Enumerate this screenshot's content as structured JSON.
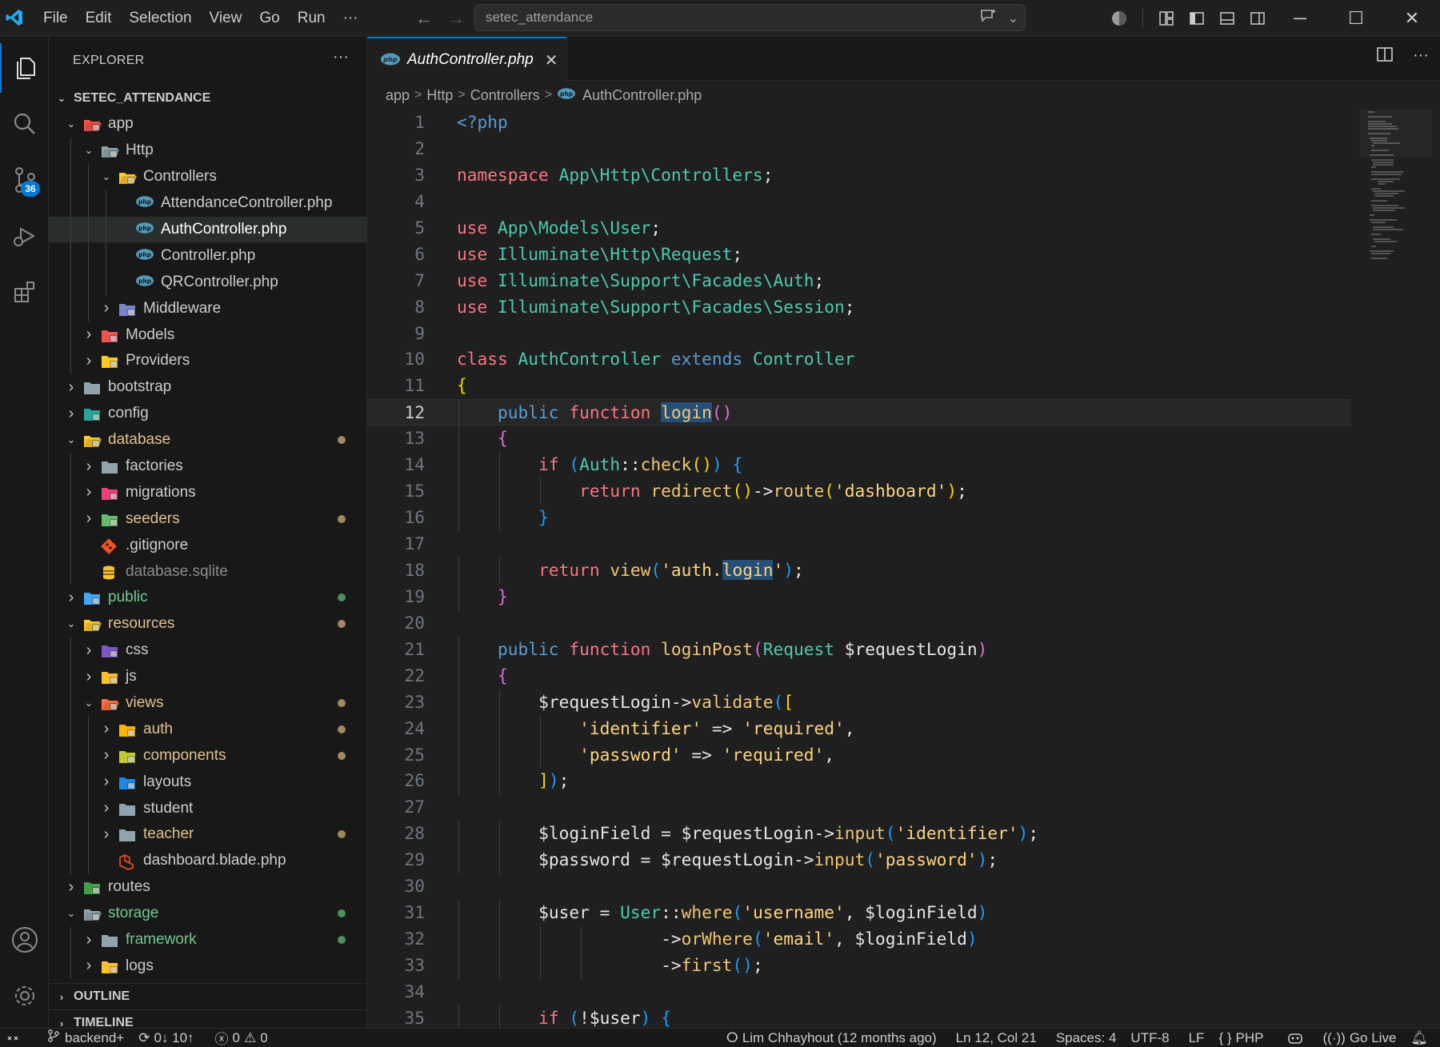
{
  "titlebar": {
    "menu": [
      "File",
      "Edit",
      "Selection",
      "View",
      "Go",
      "Run",
      "···"
    ],
    "search_text": "setec_attendance"
  },
  "activity": {
    "scm_badge": "36"
  },
  "sidebar": {
    "explorer_title": "EXPLORER",
    "project_name": "SETEC_ATTENDANCE",
    "tree": [
      {
        "label": "app",
        "depth": 0,
        "twisty": "open",
        "icon": "folder-app-icon",
        "color": "#f85149",
        "labelColor": "#cccccc"
      },
      {
        "label": "Http",
        "depth": 1,
        "twisty": "open",
        "icon": "folder-http-icon",
        "color": "#90a4ae",
        "labelColor": "#cccccc"
      },
      {
        "label": "Controllers",
        "depth": 2,
        "twisty": "open",
        "icon": "folder-controllers-icon",
        "color": "#ffca28",
        "labelColor": "#cccccc"
      },
      {
        "label": "AttendanceController.php",
        "depth": 3,
        "twisty": "none",
        "icon": "php-file-icon",
        "color": "#519aba",
        "labelColor": "#cccccc"
      },
      {
        "label": "AuthController.php",
        "depth": 3,
        "twisty": "none",
        "icon": "php-file-icon",
        "color": "#519aba",
        "labelColor": "#ffffff",
        "selected": true
      },
      {
        "label": "Controller.php",
        "depth": 3,
        "twisty": "none",
        "icon": "php-file-icon",
        "color": "#519aba",
        "labelColor": "#cccccc"
      },
      {
        "label": "QRController.php",
        "depth": 3,
        "twisty": "none",
        "icon": "php-file-icon",
        "color": "#519aba",
        "labelColor": "#cccccc"
      },
      {
        "label": "Middleware",
        "depth": 2,
        "twisty": "closed",
        "icon": "folder-middleware-icon",
        "color": "#7986cb",
        "labelColor": "#cccccc"
      },
      {
        "label": "Models",
        "depth": 1,
        "twisty": "closed",
        "icon": "folder-models-icon",
        "color": "#ef5350",
        "labelColor": "#cccccc"
      },
      {
        "label": "Providers",
        "depth": 1,
        "twisty": "closed",
        "icon": "folder-providers-icon",
        "color": "#ffca28",
        "labelColor": "#cccccc"
      },
      {
        "label": "bootstrap",
        "depth": 0,
        "twisty": "closed",
        "icon": "folder-icon",
        "color": "#90a4ae",
        "labelColor": "#cccccc"
      },
      {
        "label": "config",
        "depth": 0,
        "twisty": "closed",
        "icon": "folder-config-icon",
        "color": "#26a69a",
        "labelColor": "#cccccc"
      },
      {
        "label": "database",
        "depth": 0,
        "twisty": "open",
        "icon": "folder-database-icon",
        "color": "#ffca28",
        "labelColor": "#e2c08d",
        "dot": "#a08860"
      },
      {
        "label": "factories",
        "depth": 1,
        "twisty": "closed",
        "icon": "folder-icon",
        "color": "#90a4ae",
        "labelColor": "#cccccc"
      },
      {
        "label": "migrations",
        "depth": 1,
        "twisty": "closed",
        "icon": "folder-migrations-icon",
        "color": "#ec407a",
        "labelColor": "#cccccc"
      },
      {
        "label": "seeders",
        "depth": 1,
        "twisty": "closed",
        "icon": "folder-seeders-icon",
        "color": "#66bb6a",
        "labelColor": "#e2c08d",
        "dot": "#a08860"
      },
      {
        "label": ".gitignore",
        "depth": 1,
        "twisty": "none",
        "icon": "git-icon",
        "color": "#f4511e",
        "labelColor": "#cccccc"
      },
      {
        "label": "database.sqlite",
        "depth": 1,
        "twisty": "none",
        "icon": "database-icon",
        "color": "#fbc02d",
        "labelColor": "#8c8c8c"
      },
      {
        "label": "public",
        "depth": 0,
        "twisty": "closed",
        "icon": "folder-public-icon",
        "color": "#42a5f5",
        "labelColor": "#73c991",
        "dot": "#4e8f5e"
      },
      {
        "label": "resources",
        "depth": 0,
        "twisty": "open",
        "icon": "folder-resources-icon",
        "color": "#ffca28",
        "labelColor": "#e2c08d",
        "dot": "#a08860"
      },
      {
        "label": "css",
        "depth": 1,
        "twisty": "closed",
        "icon": "folder-css-icon",
        "color": "#7e57c2",
        "labelColor": "#cccccc"
      },
      {
        "label": "js",
        "depth": 1,
        "twisty": "closed",
        "icon": "folder-js-icon",
        "color": "#fbc02d",
        "labelColor": "#cccccc"
      },
      {
        "label": "views",
        "depth": 1,
        "twisty": "open",
        "icon": "folder-views-icon",
        "color": "#ff7043",
        "labelColor": "#e2c08d",
        "dot": "#a08860"
      },
      {
        "label": "auth",
        "depth": 2,
        "twisty": "closed",
        "icon": "folder-auth-icon",
        "color": "#ffb300",
        "labelColor": "#e2c08d",
        "dot": "#a08860"
      },
      {
        "label": "components",
        "depth": 2,
        "twisty": "closed",
        "icon": "folder-components-icon",
        "color": "#c0ca33",
        "labelColor": "#e2c08d",
        "dot": "#a08860"
      },
      {
        "label": "layouts",
        "depth": 2,
        "twisty": "closed",
        "icon": "folder-layouts-icon",
        "color": "#1e88e5",
        "labelColor": "#cccccc"
      },
      {
        "label": "student",
        "depth": 2,
        "twisty": "closed",
        "icon": "folder-icon",
        "color": "#90a4ae",
        "labelColor": "#cccccc"
      },
      {
        "label": "teacher",
        "depth": 2,
        "twisty": "closed",
        "icon": "folder-icon",
        "color": "#90a4ae",
        "labelColor": "#e2c08d",
        "dot": "#a08860"
      },
      {
        "label": "dashboard.blade.php",
        "depth": 2,
        "twisty": "none",
        "icon": "blade-file-icon",
        "color": "#f4511e",
        "labelColor": "#cccccc"
      },
      {
        "label": "routes",
        "depth": 0,
        "twisty": "closed",
        "icon": "folder-routes-icon",
        "color": "#43a047",
        "labelColor": "#cccccc"
      },
      {
        "label": "storage",
        "depth": 0,
        "twisty": "open",
        "icon": "folder-storage-icon",
        "color": "#90a4ae",
        "labelColor": "#73c991",
        "dot": "#4e8f5e"
      },
      {
        "label": "framework",
        "depth": 1,
        "twisty": "closed",
        "icon": "folder-icon",
        "color": "#90a4ae",
        "labelColor": "#73c991",
        "dot": "#4e8f5e"
      },
      {
        "label": "logs",
        "depth": 1,
        "twisty": "closed",
        "icon": "folder-logs-icon",
        "color": "#fbc02d",
        "labelColor": "#cccccc"
      }
    ],
    "outline_label": "OUTLINE",
    "timeline_label": "TIMELINE"
  },
  "editor": {
    "tab_label": "AuthController.php",
    "breadcrumb": [
      "app",
      "Http",
      "Controllers",
      "AuthController.php"
    ],
    "current_line": 12,
    "lines": [
      [
        [
          "tag",
          "<?php"
        ]
      ],
      [],
      [
        [
          "kw",
          "namespace "
        ],
        [
          "ns",
          "App\\Http\\Controllers"
        ],
        [
          "plain",
          ";"
        ]
      ],
      [],
      [
        [
          "kw",
          "use "
        ],
        [
          "ns",
          "App\\Models\\User"
        ],
        [
          "plain",
          ";"
        ]
      ],
      [
        [
          "kw",
          "use "
        ],
        [
          "ns",
          "Illuminate\\Http\\Request"
        ],
        [
          "plain",
          ";"
        ]
      ],
      [
        [
          "kw",
          "use "
        ],
        [
          "ns",
          "Illuminate\\Support\\Facades\\Auth"
        ],
        [
          "plain",
          ";"
        ]
      ],
      [
        [
          "kw",
          "use "
        ],
        [
          "ns",
          "Illuminate\\Support\\Facades\\Session"
        ],
        [
          "plain",
          ";"
        ]
      ],
      [],
      [
        [
          "kw",
          "class "
        ],
        [
          "cls",
          "AuthController "
        ],
        [
          "kw2",
          "extends "
        ],
        [
          "cls",
          "Controller"
        ]
      ],
      [
        [
          "p1",
          "{"
        ]
      ],
      [
        [
          "plain",
          "    "
        ],
        [
          "kw2",
          "public "
        ],
        [
          "kw",
          "function "
        ],
        [
          "fnhl",
          "login"
        ],
        [
          "p2",
          "()"
        ]
      ],
      [
        [
          "plain",
          "    "
        ],
        [
          "p2",
          "{"
        ]
      ],
      [
        [
          "plain",
          "        "
        ],
        [
          "kw",
          "if "
        ],
        [
          "p3",
          "("
        ],
        [
          "cls",
          "Auth"
        ],
        [
          "plain",
          "::"
        ],
        [
          "fn",
          "check"
        ],
        [
          "p1",
          "()"
        ],
        [
          "p3",
          ")"
        ],
        [
          "plain",
          " "
        ],
        [
          "p3",
          "{"
        ]
      ],
      [
        [
          "plain",
          "            "
        ],
        [
          "kw",
          "return "
        ],
        [
          "fn",
          "redirect"
        ],
        [
          "p1",
          "()"
        ],
        [
          "plain",
          "->"
        ],
        [
          "fn",
          "route"
        ],
        [
          "p1",
          "("
        ],
        [
          "str",
          "'dashboard'"
        ],
        [
          "p1",
          ")"
        ],
        [
          "plain",
          ";"
        ]
      ],
      [
        [
          "plain",
          "        "
        ],
        [
          "p3",
          "}"
        ]
      ],
      [],
      [
        [
          "plain",
          "        "
        ],
        [
          "kw",
          "return "
        ],
        [
          "fn",
          "view"
        ],
        [
          "p3",
          "("
        ],
        [
          "str",
          "'auth."
        ],
        [
          "strhl",
          "login"
        ],
        [
          "str",
          "'"
        ],
        [
          "p3",
          ")"
        ],
        [
          "plain",
          ";"
        ]
      ],
      [
        [
          "plain",
          "    "
        ],
        [
          "p2",
          "}"
        ]
      ],
      [],
      [
        [
          "plain",
          "    "
        ],
        [
          "kw2",
          "public "
        ],
        [
          "kw",
          "function "
        ],
        [
          "fn",
          "loginPost"
        ],
        [
          "p2",
          "("
        ],
        [
          "cls",
          "Request "
        ],
        [
          "var",
          "$requestLogin"
        ],
        [
          "p2",
          ")"
        ]
      ],
      [
        [
          "plain",
          "    "
        ],
        [
          "p2",
          "{"
        ]
      ],
      [
        [
          "plain",
          "        "
        ],
        [
          "var",
          "$requestLogin"
        ],
        [
          "plain",
          "->"
        ],
        [
          "fn",
          "validate"
        ],
        [
          "p3",
          "("
        ],
        [
          "p1",
          "["
        ]
      ],
      [
        [
          "plain",
          "            "
        ],
        [
          "str",
          "'identifier'"
        ],
        [
          "plain",
          " => "
        ],
        [
          "str",
          "'required'"
        ],
        [
          "plain",
          ","
        ]
      ],
      [
        [
          "plain",
          "            "
        ],
        [
          "str",
          "'password'"
        ],
        [
          "plain",
          " => "
        ],
        [
          "str",
          "'required'"
        ],
        [
          "plain",
          ","
        ]
      ],
      [
        [
          "plain",
          "        "
        ],
        [
          "p1",
          "]"
        ],
        [
          "p3",
          ")"
        ],
        [
          "plain",
          ";"
        ]
      ],
      [],
      [
        [
          "plain",
          "        "
        ],
        [
          "var",
          "$loginField"
        ],
        [
          "plain",
          " = "
        ],
        [
          "var",
          "$requestLogin"
        ],
        [
          "plain",
          "->"
        ],
        [
          "fn",
          "input"
        ],
        [
          "p3",
          "("
        ],
        [
          "str",
          "'identifier'"
        ],
        [
          "p3",
          ")"
        ],
        [
          "plain",
          ";"
        ]
      ],
      [
        [
          "plain",
          "        "
        ],
        [
          "var",
          "$password"
        ],
        [
          "plain",
          " = "
        ],
        [
          "var",
          "$requestLogin"
        ],
        [
          "plain",
          "->"
        ],
        [
          "fn",
          "input"
        ],
        [
          "p3",
          "("
        ],
        [
          "str",
          "'password'"
        ],
        [
          "p3",
          ")"
        ],
        [
          "plain",
          ";"
        ]
      ],
      [],
      [
        [
          "plain",
          "        "
        ],
        [
          "var",
          "$user"
        ],
        [
          "plain",
          " = "
        ],
        [
          "cls",
          "User"
        ],
        [
          "plain",
          "::"
        ],
        [
          "fn",
          "where"
        ],
        [
          "p3",
          "("
        ],
        [
          "str",
          "'username'"
        ],
        [
          "plain",
          ", "
        ],
        [
          "var",
          "$loginField"
        ],
        [
          "p3",
          ")"
        ]
      ],
      [
        [
          "plain",
          "                    "
        ],
        [
          "plain",
          "->"
        ],
        [
          "fn",
          "orWhere"
        ],
        [
          "p3",
          "("
        ],
        [
          "str",
          "'email'"
        ],
        [
          "plain",
          ", "
        ],
        [
          "var",
          "$loginField"
        ],
        [
          "p3",
          ")"
        ]
      ],
      [
        [
          "plain",
          "                    "
        ],
        [
          "plain",
          "->"
        ],
        [
          "fn",
          "first"
        ],
        [
          "p3",
          "()"
        ],
        [
          "plain",
          ";"
        ]
      ],
      [],
      [
        [
          "plain",
          "        "
        ],
        [
          "kw",
          "if "
        ],
        [
          "p3",
          "("
        ],
        [
          "plain",
          "!"
        ],
        [
          "var",
          "$user"
        ],
        [
          "p3",
          ")"
        ],
        [
          "plain",
          " "
        ],
        [
          "p3",
          "{"
        ]
      ]
    ]
  },
  "statusbar": {
    "branch": "backend+",
    "sync": "0↓ 10↑",
    "errors": "0",
    "warnings": "0",
    "blame": "Lim Chhayhout (12 months ago)",
    "position": "Ln 12, Col 21",
    "spaces": "Spaces: 4",
    "encoding": "UTF-8",
    "eol": "LF",
    "language": "PHP",
    "golive": "Go Live"
  },
  "colors": {
    "accent": "#0078d4",
    "background": "#1f1f1f",
    "sidebar": "#181818"
  }
}
